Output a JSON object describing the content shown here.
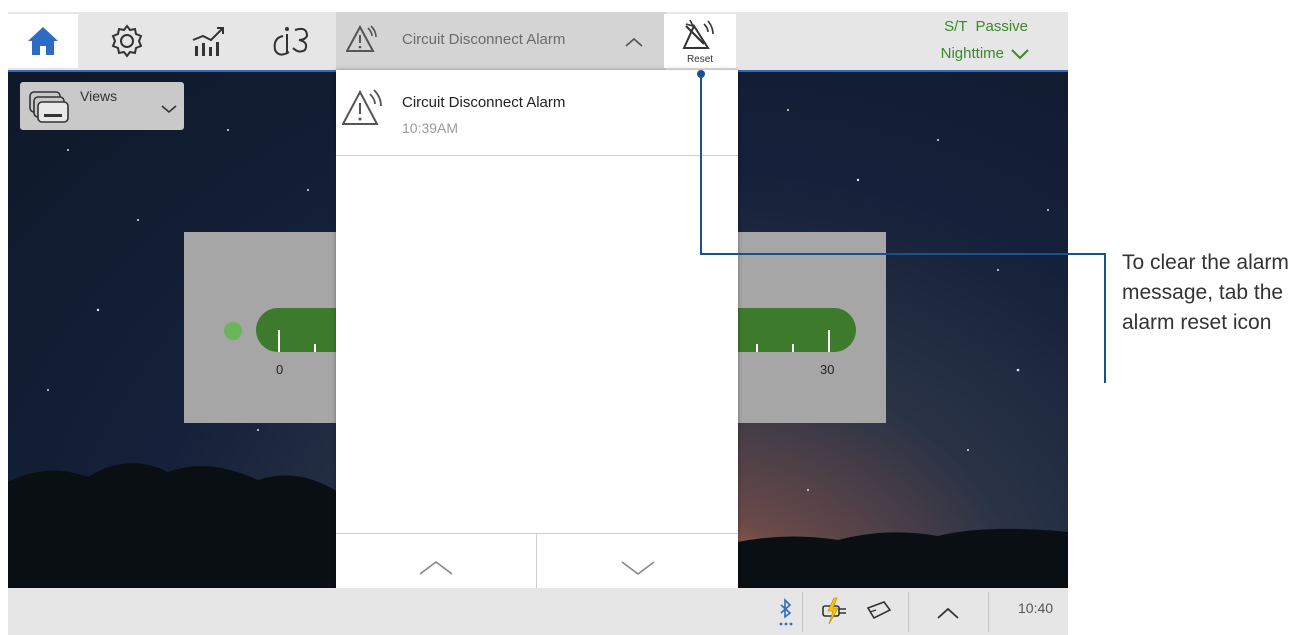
{
  "alarm_banner": {
    "label": "Circuit Disconnect Alarm"
  },
  "reset_button": {
    "label": "Reset"
  },
  "status": {
    "mode": "S/T  Passive",
    "profile": "Nighttime"
  },
  "views": {
    "label": "Views"
  },
  "alarm_list": {
    "items": [
      {
        "title": "Circuit Disconnect Alarm",
        "time": "10:39AM"
      }
    ]
  },
  "gauge": {
    "min_label": "0",
    "max_label": "30"
  },
  "bottom": {
    "time": "10:40"
  },
  "callout": {
    "text": "To clear the alarm message, tab the alarm reset icon"
  },
  "icons": [
    "home-icon",
    "settings-gear-icon",
    "trends-chart-icon",
    "info-icon",
    "alarm-triangle-icon",
    "chevron-up-icon",
    "alarm-reset-icon",
    "chevron-down-icon",
    "views-layers-icon",
    "bluetooth-icon",
    "power-plug-icon",
    "sd-card-icon"
  ],
  "colors": {
    "accent": "#2e6bc2",
    "status_green": "#3a8a2a",
    "gauge_green": "#3d7a2c",
    "callout_blue": "#1a4f93",
    "charge_yellow": "#f0c419"
  }
}
